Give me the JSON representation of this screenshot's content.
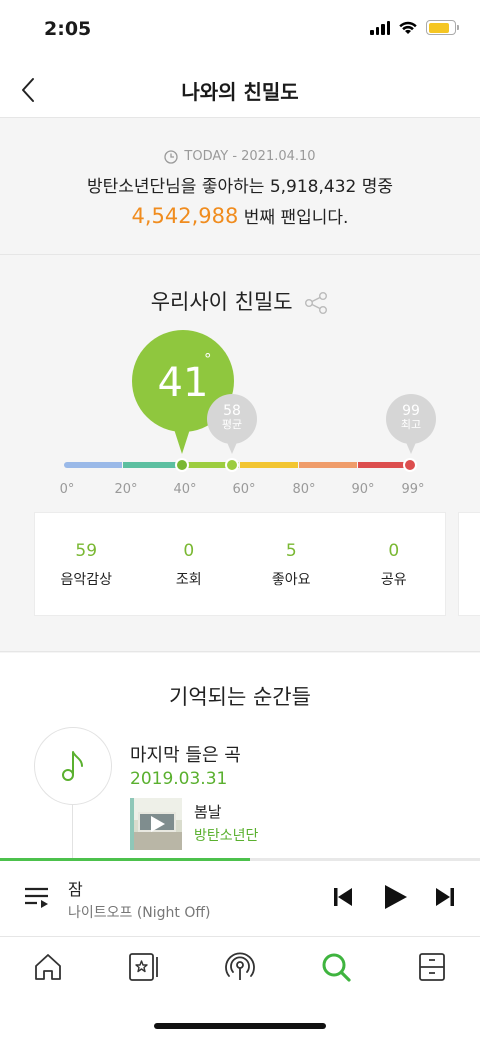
{
  "status_bar": {
    "time": "2:05"
  },
  "header": {
    "title": "나와의 친밀도"
  },
  "fan_info": {
    "today_label": "TODAY - 2021.04.10",
    "line1": "방탄소년단님을 좋아하는 5,918,432 명중",
    "rank": "4,542,988",
    "line2_suffix": " 번째 팬입니다."
  },
  "intimacy": {
    "title": "우리사이 친밀도",
    "current": {
      "value": "41",
      "degree": "°"
    },
    "average": {
      "value": "58",
      "label": "평균"
    },
    "max": {
      "value": "99",
      "label": "최고"
    },
    "scale_labels": [
      "0°",
      "20°",
      "40°",
      "60°",
      "80°",
      "90°",
      "99°"
    ],
    "gauge_colors": [
      "#9ab9e8",
      "#5cbfa0",
      "#9ccd3f",
      "#f2c531",
      "#ef9c6a",
      "#dc4e4e"
    ],
    "stats": [
      {
        "value": "59",
        "label": "음악감상"
      },
      {
        "value": "0",
        "label": "조회"
      },
      {
        "value": "5",
        "label": "좋아요"
      },
      {
        "value": "0",
        "label": "공유"
      }
    ]
  },
  "memories": {
    "title": "기억되는 순간들",
    "item": {
      "heading": "마지막 들은 곡",
      "date": "2019.03.31",
      "song_title": "봄날",
      "song_artist": "방탄소년단"
    }
  },
  "player": {
    "title": "잠",
    "artist": "나이트오프 (Night Off)",
    "progress": 0.52
  },
  "colors": {
    "accent_green": "#5ab02f",
    "rank_orange": "#f08c1e",
    "bubble_green": "#8fc73e",
    "progress_green": "#4cc14c"
  },
  "icons": {
    "back": "chevron-left-icon",
    "share": "share-icon",
    "clock": "clock-icon",
    "note": "music-note-icon",
    "tabs": [
      "home-icon",
      "my-music-icon",
      "podcast-icon",
      "search-icon",
      "drawer-icon"
    ]
  }
}
